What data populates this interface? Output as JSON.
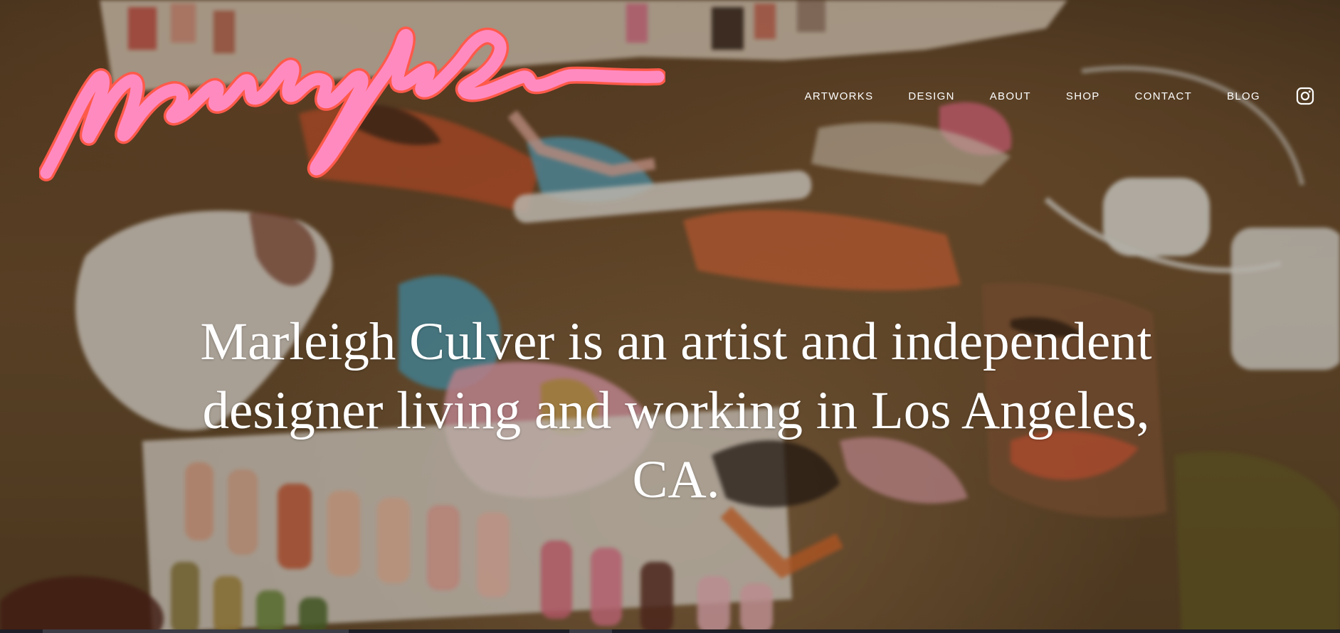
{
  "brand": {
    "logo_text": "Marleigh Culver",
    "logo_color": "#ff8ac0",
    "logo_outline_color": "#ff5a4a"
  },
  "nav": {
    "items": [
      {
        "label": "ARTWORKS"
      },
      {
        "label": "DESIGN"
      },
      {
        "label": "ABOUT"
      },
      {
        "label": "SHOP"
      },
      {
        "label": "CONTACT"
      },
      {
        "label": "BLOG"
      }
    ],
    "social_icon": "instagram-icon"
  },
  "hero": {
    "headline": "Marleigh Culver is an artist and independent designer living and working in Los Angeles, CA.",
    "text_color": "#ffffff"
  }
}
